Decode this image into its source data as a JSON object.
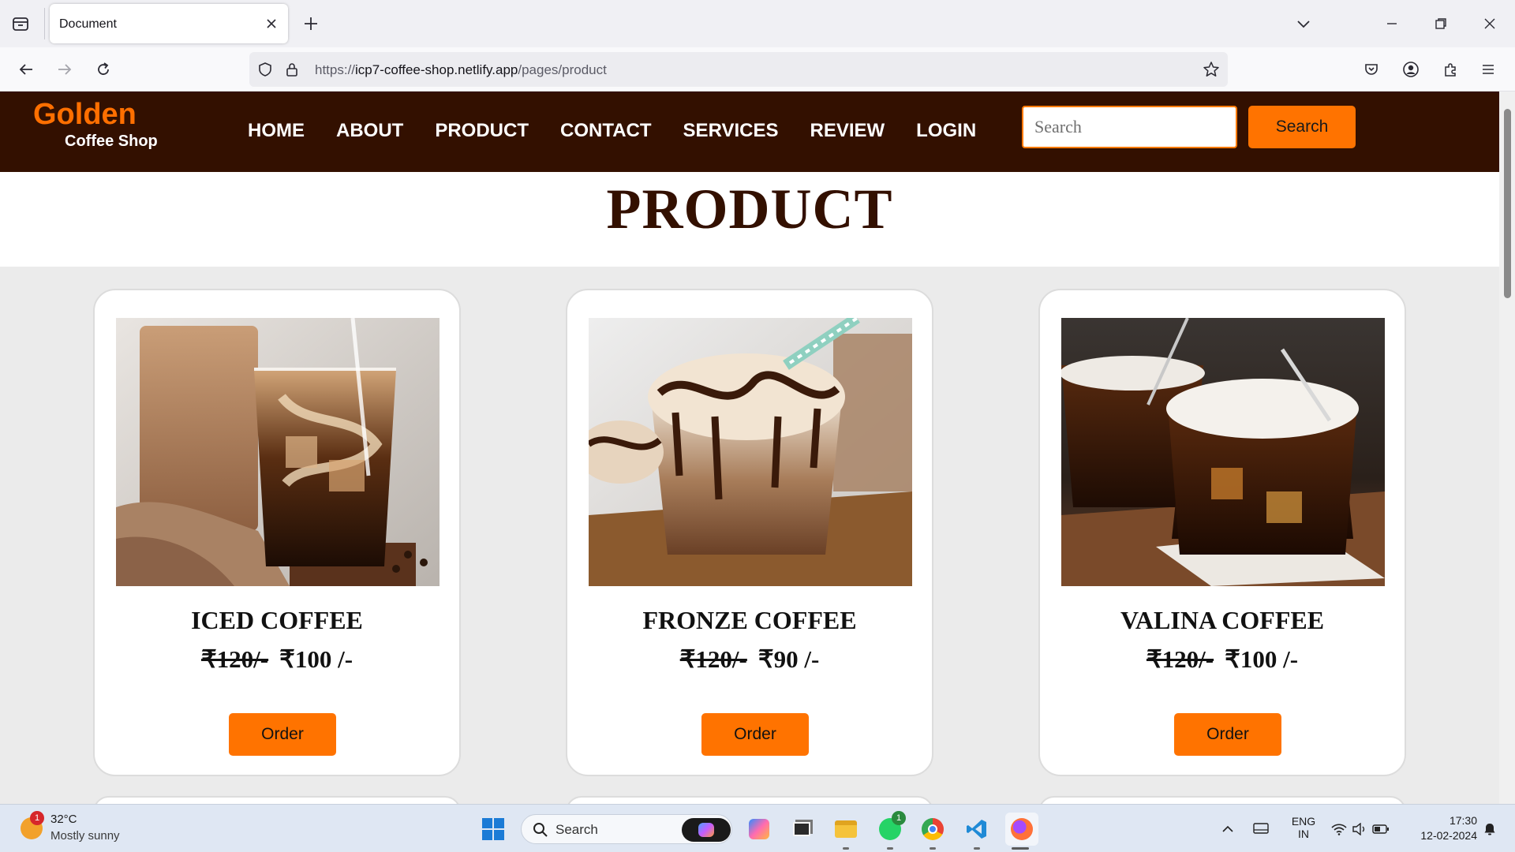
{
  "browser": {
    "tab_title": "Document",
    "url_prefix": "https://",
    "url_host": "icp7-coffee-shop.netlify.app",
    "url_path": "/pages/product"
  },
  "site": {
    "logo_main": "Golden",
    "logo_sub": "Coffee Shop",
    "nav": [
      "HOME",
      "ABOUT",
      "PRODUCT",
      "CONTACT",
      "SERVICES",
      "REVIEW",
      "LOGIN"
    ],
    "search_placeholder": "Search",
    "search_button": "Search",
    "heading": "PRODUCT"
  },
  "products": [
    {
      "name": "ICED COFFEE",
      "old_price": "₹120/-",
      "price": "₹100 /-",
      "button": "Order"
    },
    {
      "name": "FRONZE COFFEE",
      "old_price": "₹120/-",
      "price": "₹90 /-",
      "button": "Order"
    },
    {
      "name": "VALINA COFFEE",
      "old_price": "₹120/-",
      "price": "₹100 /-",
      "button": "Order"
    }
  ],
  "taskbar": {
    "weather_badge": "1",
    "weather_temp": "32°C",
    "weather_desc": "Mostly sunny",
    "search_label": "Search",
    "lang_top": "ENG",
    "lang_bottom": "IN",
    "time": "17:30",
    "date": "12-02-2024",
    "whatsapp_badge": "1"
  },
  "colors": {
    "header_bg": "#331000",
    "accent": "#ff7300",
    "logo": "#ff6f00"
  }
}
